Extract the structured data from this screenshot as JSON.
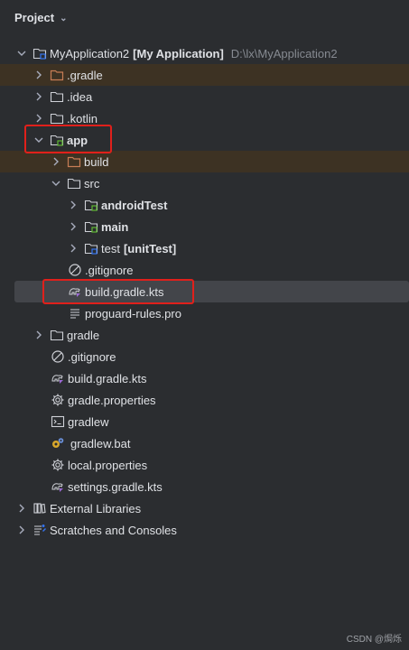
{
  "panel": {
    "title": "Project"
  },
  "tree": {
    "root": {
      "name": "MyApplication2",
      "module": "[My Application]",
      "path": "D:\\lx\\MyApplication2"
    },
    "gradle_dir": ".gradle",
    "idea_dir": ".idea",
    "kotlin_dir": ".kotlin",
    "app": "app",
    "app_build": "build",
    "app_src": "src",
    "android_test": "androidTest",
    "main": "main",
    "test_name": "test",
    "test_tag": "[unitTest]",
    "app_gitignore": ".gitignore",
    "app_build_gradle": "build.gradle.kts",
    "proguard": "proguard-rules.pro",
    "gradle": "gradle",
    "root_gitignore": ".gitignore",
    "root_build_gradle": "build.gradle.kts",
    "gradle_properties": "gradle.properties",
    "gradlew": "gradlew",
    "gradlew_bat": "gradlew.bat",
    "local_properties": "local.properties",
    "settings_gradle": "settings.gradle.kts",
    "external_libraries": "External Libraries",
    "scratches": "Scratches and Consoles"
  },
  "watermark": "CSDN @焗烁"
}
